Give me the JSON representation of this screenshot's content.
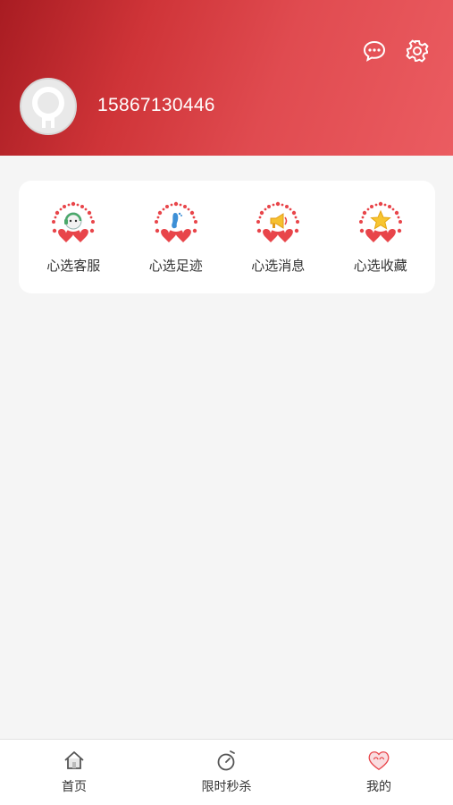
{
  "profile": {
    "phone": "15867130446"
  },
  "header": {
    "icons": [
      "chat-icon",
      "gear-icon"
    ]
  },
  "shortcuts": [
    {
      "label": "心选客服",
      "icon": "customer-service-icon"
    },
    {
      "label": "心选足迹",
      "icon": "footprint-icon"
    },
    {
      "label": "心选消息",
      "icon": "message-megaphone-icon"
    },
    {
      "label": "心选收藏",
      "icon": "favorite-star-icon"
    }
  ],
  "tabbar": [
    {
      "label": "首页",
      "icon": "home-icon"
    },
    {
      "label": "限时秒杀",
      "icon": "stopwatch-icon"
    },
    {
      "label": "我的",
      "icon": "heart-my-icon"
    }
  ],
  "colors": {
    "header_start": "#a81c22",
    "header_end": "#eb5c61",
    "accent": "#e0363c"
  }
}
